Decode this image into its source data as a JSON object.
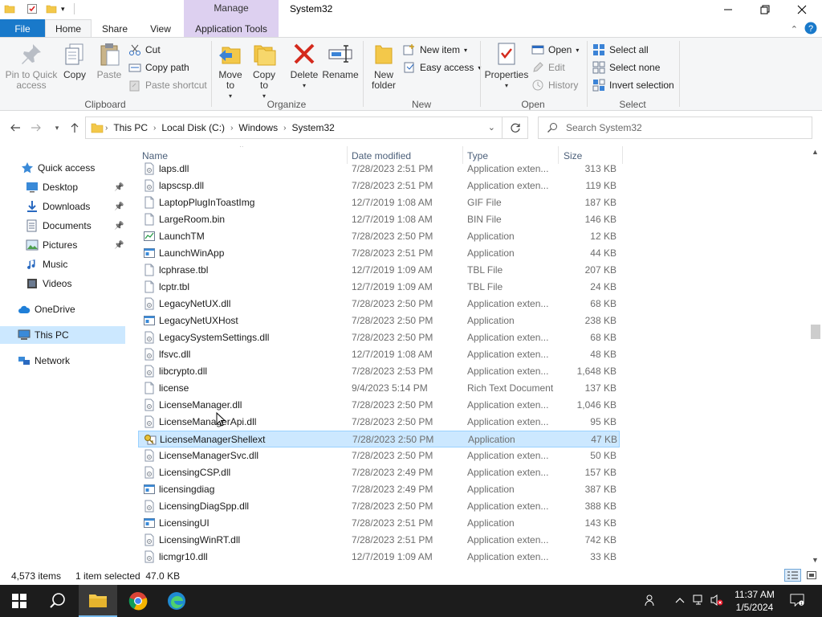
{
  "window": {
    "title": "System32",
    "context_group": "Manage"
  },
  "tabs": {
    "file": "File",
    "home": "Home",
    "share": "Share",
    "view": "View",
    "app_tools": "Application Tools"
  },
  "ribbon": {
    "clipboard": {
      "label": "Clipboard",
      "pin": [
        "Pin to Quick",
        "access"
      ],
      "copy": "Copy",
      "paste": "Paste",
      "cut": "Cut",
      "copy_path": "Copy path",
      "paste_shortcut": "Paste shortcut"
    },
    "organize": {
      "label": "Organize",
      "move_to": [
        "Move",
        "to"
      ],
      "copy_to": [
        "Copy",
        "to"
      ],
      "delete": "Delete",
      "rename": "Rename"
    },
    "new": {
      "label": "New",
      "new_folder": [
        "New",
        "folder"
      ],
      "new_item": "New item",
      "easy_access": "Easy access"
    },
    "open": {
      "label": "Open",
      "properties": "Properties",
      "open": "Open",
      "edit": "Edit",
      "history": "History"
    },
    "select": {
      "label": "Select",
      "select_all": "Select all",
      "select_none": "Select none",
      "invert": "Invert selection"
    }
  },
  "address": {
    "crumbs": [
      "This PC",
      "Local Disk (C:)",
      "Windows",
      "System32"
    ],
    "search_placeholder": "Search System32"
  },
  "nav": {
    "items": [
      {
        "label": "Quick access",
        "icon": "star-icon"
      },
      {
        "label": "Desktop",
        "icon": "desktop-icon",
        "pinned": true
      },
      {
        "label": "Downloads",
        "icon": "download-icon",
        "pinned": true
      },
      {
        "label": "Documents",
        "icon": "documents-icon",
        "pinned": true
      },
      {
        "label": "Pictures",
        "icon": "pictures-icon",
        "pinned": true
      },
      {
        "label": "Music",
        "icon": "music-icon"
      },
      {
        "label": "Videos",
        "icon": "videos-icon"
      },
      {
        "label": "OneDrive",
        "icon": "cloud-icon"
      },
      {
        "label": "This PC",
        "icon": "computer-icon",
        "selected": true
      },
      {
        "label": "Network",
        "icon": "network-icon"
      }
    ]
  },
  "columns": {
    "name": "Name",
    "date": "Date modified",
    "type": "Type",
    "size": "Size"
  },
  "files": [
    {
      "name": "laps.dll",
      "date": "7/28/2023 2:51 PM",
      "type": "Application exten...",
      "size": "313 KB",
      "icon": "dll"
    },
    {
      "name": "lapscsp.dll",
      "date": "7/28/2023 2:51 PM",
      "type": "Application exten...",
      "size": "119 KB",
      "icon": "dll"
    },
    {
      "name": "LaptopPlugInToastImg",
      "date": "12/7/2019 1:08 AM",
      "type": "GIF File",
      "size": "187 KB",
      "icon": "file"
    },
    {
      "name": "LargeRoom.bin",
      "date": "12/7/2019 1:08 AM",
      "type": "BIN File",
      "size": "146 KB",
      "icon": "file"
    },
    {
      "name": "LaunchTM",
      "date": "7/28/2023 2:50 PM",
      "type": "Application",
      "size": "12 KB",
      "icon": "chart-app"
    },
    {
      "name": "LaunchWinApp",
      "date": "7/28/2023 2:51 PM",
      "type": "Application",
      "size": "44 KB",
      "icon": "app"
    },
    {
      "name": "lcphrase.tbl",
      "date": "12/7/2019 1:09 AM",
      "type": "TBL File",
      "size": "207 KB",
      "icon": "file"
    },
    {
      "name": "lcptr.tbl",
      "date": "12/7/2019 1:09 AM",
      "type": "TBL File",
      "size": "24 KB",
      "icon": "file"
    },
    {
      "name": "LegacyNetUX.dll",
      "date": "7/28/2023 2:50 PM",
      "type": "Application exten...",
      "size": "68 KB",
      "icon": "dll"
    },
    {
      "name": "LegacyNetUXHost",
      "date": "7/28/2023 2:50 PM",
      "type": "Application",
      "size": "238 KB",
      "icon": "app"
    },
    {
      "name": "LegacySystemSettings.dll",
      "date": "7/28/2023 2:50 PM",
      "type": "Application exten...",
      "size": "68 KB",
      "icon": "dll"
    },
    {
      "name": "lfsvc.dll",
      "date": "12/7/2019 1:08 AM",
      "type": "Application exten...",
      "size": "48 KB",
      "icon": "dll"
    },
    {
      "name": "libcrypto.dll",
      "date": "7/28/2023 2:53 PM",
      "type": "Application exten...",
      "size": "1,648 KB",
      "icon": "dll"
    },
    {
      "name": "license",
      "date": "9/4/2023 5:14 PM",
      "type": "Rich Text Document",
      "size": "137 KB",
      "icon": "file"
    },
    {
      "name": "LicenseManager.dll",
      "date": "7/28/2023 2:50 PM",
      "type": "Application exten...",
      "size": "1,046 KB",
      "icon": "dll"
    },
    {
      "name": "LicenseManagerApi.dll",
      "date": "7/28/2023 2:50 PM",
      "type": "Application exten...",
      "size": "95 KB",
      "icon": "dll"
    },
    {
      "name": "LicenseManagerShellext",
      "date": "7/28/2023 2:50 PM",
      "type": "Application",
      "size": "47 KB",
      "icon": "key-app",
      "selected": true
    },
    {
      "name": "LicenseManagerSvc.dll",
      "date": "7/28/2023 2:50 PM",
      "type": "Application exten...",
      "size": "50 KB",
      "icon": "dll"
    },
    {
      "name": "LicensingCSP.dll",
      "date": "7/28/2023 2:49 PM",
      "type": "Application exten...",
      "size": "157 KB",
      "icon": "dll"
    },
    {
      "name": "licensingdiag",
      "date": "7/28/2023 2:49 PM",
      "type": "Application",
      "size": "387 KB",
      "icon": "app"
    },
    {
      "name": "LicensingDiagSpp.dll",
      "date": "7/28/2023 2:50 PM",
      "type": "Application exten...",
      "size": "388 KB",
      "icon": "dll"
    },
    {
      "name": "LicensingUI",
      "date": "7/28/2023 2:51 PM",
      "type": "Application",
      "size": "143 KB",
      "icon": "app"
    },
    {
      "name": "LicensingWinRT.dll",
      "date": "7/28/2023 2:51 PM",
      "type": "Application exten...",
      "size": "742 KB",
      "icon": "dll"
    },
    {
      "name": "licmgr10.dll",
      "date": "12/7/2019 1:09 AM",
      "type": "Application exten...",
      "size": "33 KB",
      "icon": "dll"
    }
  ],
  "status": {
    "item_count": "4,573 items",
    "selection": "1 item selected  47.0 KB"
  },
  "clock": {
    "time": "11:37 AM",
    "date": "1/5/2024"
  },
  "colors": {
    "accent": "#1979ca",
    "selection": "#cce8ff",
    "context_tab": "#ddd0f0",
    "taskbar": "#1c1c1c"
  }
}
